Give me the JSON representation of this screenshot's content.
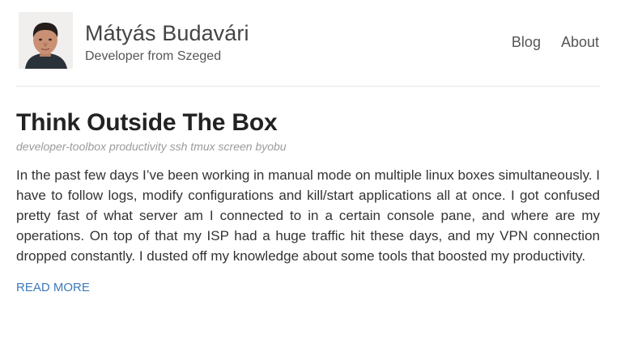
{
  "header": {
    "site_title": "Mátyás Budavári",
    "site_subtitle": "Developer from Szeged",
    "avatar_icon": "developer-portrait"
  },
  "nav": {
    "blog": "Blog",
    "about": "About"
  },
  "post": {
    "title": "Think Outside The Box",
    "tags": "developer-toolbox productivity ssh tmux screen byobu",
    "excerpt": "In the past few days I’ve been working in manual mode on multiple linux boxes simultaneously. I have to follow logs, modify configurations and kill/start applications all at once. I got confused pretty fast of what server am I connected to in a certain console pane, and where are my operations. On top of that my ISP had a huge traffic hit these days, and my VPN connection dropped constantly. I dusted off my knowledge about some tools that boosted my productivity.",
    "read_more": "READ MORE"
  },
  "colors": {
    "link": "#3d7ab8",
    "text": "#333333",
    "muted": "#9b9b9b",
    "divider": "#e6e6e6"
  }
}
